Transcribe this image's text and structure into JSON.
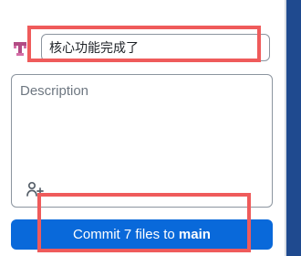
{
  "commit_panel": {
    "summary_value": "核心功能完成了",
    "description_placeholder": "Description",
    "commit_button_prefix": "Commit 7 files to ",
    "commit_button_branch": "main"
  },
  "icons": {
    "author_avatar": "author-avatar-icon",
    "add_coauthor": "add-coauthor-icon"
  },
  "colors": {
    "button": "#0969da",
    "highlight": "#ef5b5b",
    "right_edge": "#1f4a8f"
  }
}
